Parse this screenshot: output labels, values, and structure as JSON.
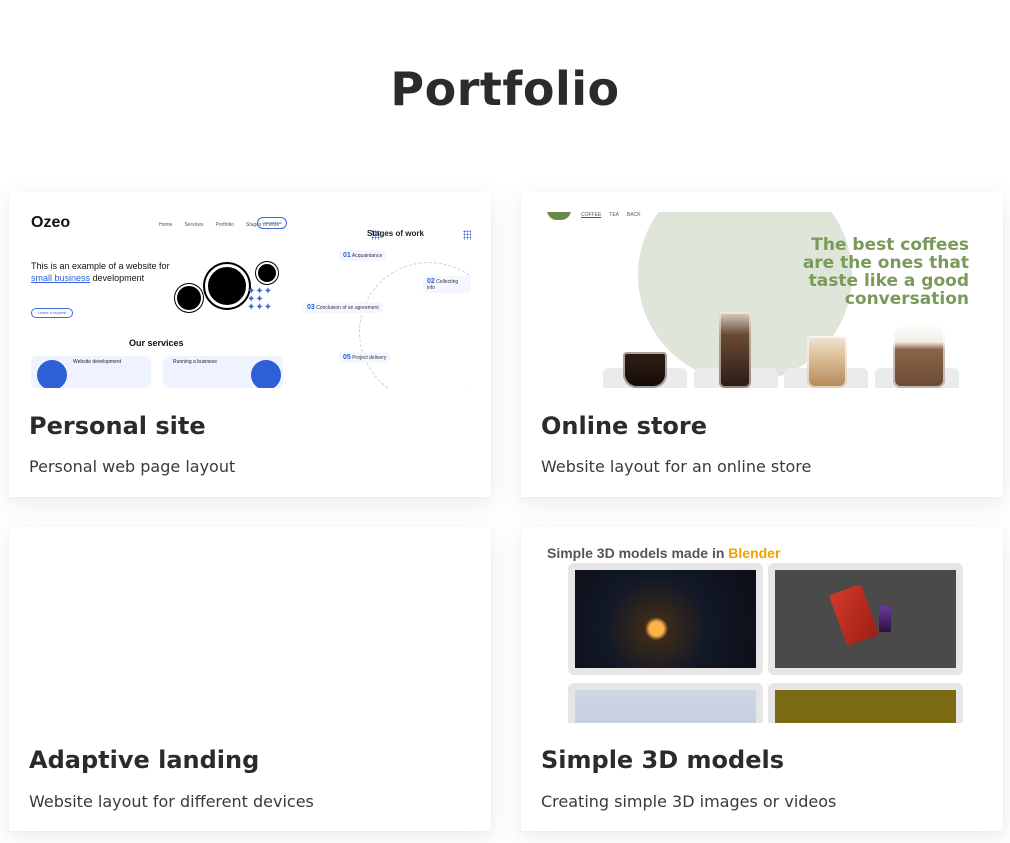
{
  "page": {
    "title": "Portfolio"
  },
  "cards": [
    {
      "title": "Personal site",
      "description": "Personal web page layout",
      "preview": {
        "logo": "Ozeo",
        "nav": [
          "Home",
          "Services",
          "Portfolio",
          "Stages of work"
        ],
        "contact": "Contact us",
        "headline_prefix": "This is an example of a website for",
        "headline_highlight": "small business",
        "headline_suffix": "development",
        "button": "Leave a request",
        "services_title": "Our services",
        "service_1": "Website development",
        "service_2": "Running a business",
        "stages_title": "Stages of work",
        "steps": [
          {
            "num": "01",
            "label": "Acquaintance"
          },
          {
            "num": "02",
            "label": "Collecting info"
          },
          {
            "num": "03",
            "label": "Conclusion of an agreement"
          },
          {
            "num": "05",
            "label": "Project delivery"
          }
        ]
      }
    },
    {
      "title": "Online store",
      "description": "Website layout for an online store",
      "preview": {
        "nav": [
          "COFFEE",
          "TEA",
          "BACK"
        ],
        "tagline": "The best coffees are the ones that taste like a good conversation"
      }
    },
    {
      "title": "Adaptive landing",
      "description": "Website layout for different devices"
    },
    {
      "title": "Simple 3D models",
      "description": "Creating simple 3D images or videos",
      "preview": {
        "heading_prefix": "Simple 3D models made in",
        "heading_highlight": "Blender"
      }
    }
  ],
  "colors": {
    "accent_blue": "#2e5fd6",
    "coffee_green": "#7a9a5a",
    "blender_orange": "#f0a300"
  }
}
